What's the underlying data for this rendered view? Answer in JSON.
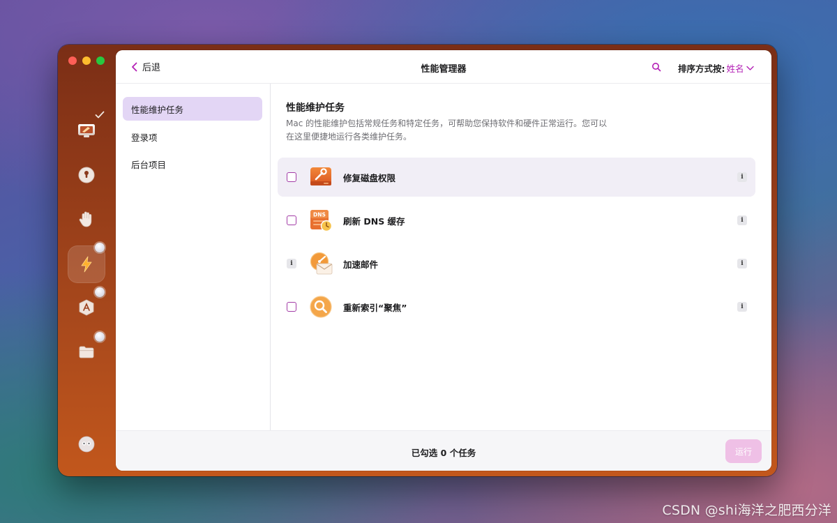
{
  "window": {
    "title": "性能管理器"
  },
  "header": {
    "back_label": "后退",
    "title": "性能管理器",
    "sort_label": "排序方式按:",
    "sort_value": "姓名"
  },
  "sidebar": {
    "items": [
      {
        "label": "性能维护任务",
        "selected": true
      },
      {
        "label": "登录项",
        "selected": false
      },
      {
        "label": "后台项目",
        "selected": false
      }
    ]
  },
  "main": {
    "title": "性能维护任务",
    "description": "Mac 的性能维护包括常规任务和特定任务，可帮助您保持软件和硬件正常运行。您可以在这里便捷地运行各类维护任务。",
    "tasks": [
      {
        "label": "修复磁盘权限",
        "icon": "disk-repair-icon",
        "checkbox": true,
        "highlighted": true
      },
      {
        "label": "刷新 DNS 缓存",
        "icon": "dns-cache-icon",
        "checkbox": true,
        "highlighted": false
      },
      {
        "label": "加速邮件",
        "icon": "mail-speed-icon",
        "checkbox": false,
        "highlighted": false
      },
      {
        "label": "重新索引“聚焦”",
        "icon": "spotlight-icon",
        "checkbox": true,
        "highlighted": false
      }
    ],
    "info_glyph": "i"
  },
  "footer": {
    "status": "已勾选 0 个任务",
    "run_label": "运行"
  },
  "rail": {
    "icons": [
      "cleanup-icon",
      "privacy-icon",
      "protection-icon",
      "performance-icon",
      "applications-icon",
      "files-icon",
      "assistant-icon"
    ]
  },
  "watermark": "CSDN @shi海洋之肥西分洋",
  "colors": {
    "accent": "#b31fb5",
    "sidebar_selected": "#e3d6f5",
    "row_highlight": "#f1eef6",
    "run_button": "#efc0e6"
  }
}
